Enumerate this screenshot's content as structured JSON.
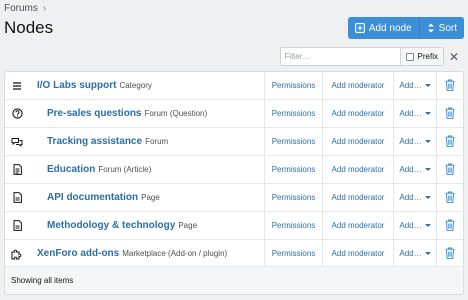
{
  "breadcrumb": {
    "items": [
      "Forums"
    ],
    "separator": "›"
  },
  "page": {
    "title": "Nodes"
  },
  "toolbar": {
    "add_node": "Add node",
    "sort": "Sort"
  },
  "filter": {
    "placeholder": "Filter…",
    "value": "",
    "prefix_label": "Prefix",
    "prefix_checked": false,
    "clear": "✕"
  },
  "nodes": [
    {
      "title": "I/O Labs support",
      "type": "Category",
      "icon": "category-icon",
      "depth": 0
    },
    {
      "title": "Pre-sales questions",
      "type": "Forum (Question)",
      "icon": "question-icon",
      "depth": 1
    },
    {
      "title": "Tracking assistance",
      "type": "Forum",
      "icon": "forum-icon",
      "depth": 1
    },
    {
      "title": "Education",
      "type": "Forum (Article)",
      "icon": "article-icon",
      "depth": 1
    },
    {
      "title": "API documentation",
      "type": "Page",
      "icon": "page-icon",
      "depth": 1
    },
    {
      "title": "Methodology & technology",
      "type": "Page",
      "icon": "page-icon",
      "depth": 1
    },
    {
      "title": "XenForo add-ons",
      "type": "Marketplace (Add-on / plugin)",
      "icon": "puzzle-icon",
      "depth": 0
    }
  ],
  "row_actions": {
    "permissions": "Permissions",
    "add_moderator": "Add moderator",
    "add": "Add…"
  },
  "footer": {
    "status": "Showing all items"
  },
  "colors": {
    "accent": "#3a8fd6",
    "link": "#2b6ea8",
    "delete": "#3a8fd6"
  }
}
